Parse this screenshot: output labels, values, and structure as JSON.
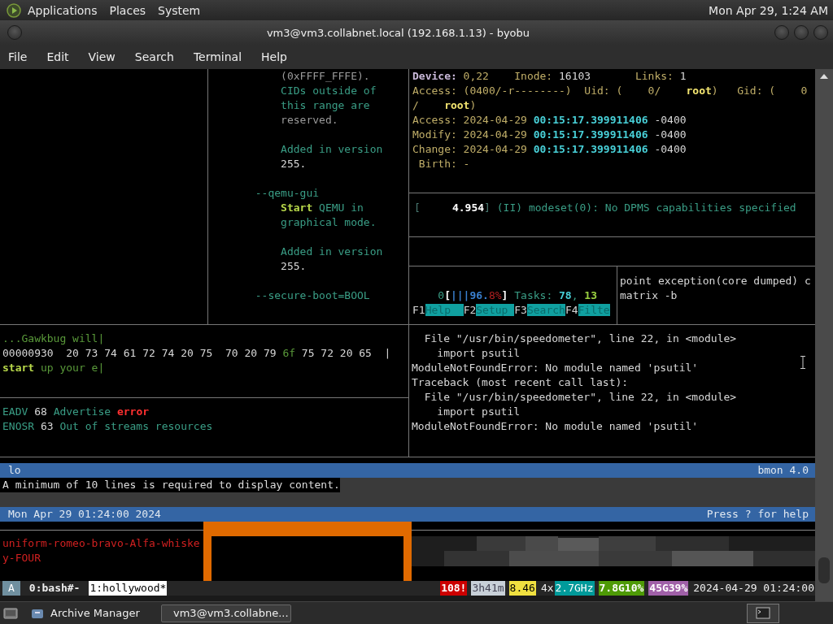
{
  "top_panel": {
    "menus": [
      "Applications",
      "Places",
      "System"
    ],
    "clock": "Mon Apr 29, 1:24 AM"
  },
  "window": {
    "title": "vm3@vm3.collabnet.local (192.168.1.13) - byobu"
  },
  "menu_bar": [
    "File",
    "Edit",
    "View",
    "Search",
    "Terminal",
    "Help"
  ],
  "panes": {
    "man_page": [
      [
        [
          {
            "text": "           (0xFFFF_FFFE).",
            "kind": "dim"
          }
        ],
        [
          {
            "text": "           CIDs outside of",
            "kind": "teal"
          }
        ],
        [
          {
            "text": "           this range are",
            "kind": "teal"
          }
        ],
        [
          {
            "text": "           reserved.",
            "kind": "dim"
          }
        ]
      ],
      [
        [
          {
            "text": "           Added in version",
            "kind": "teal"
          }
        ],
        [
          {
            "text": "           255.",
            "kind": "plain"
          }
        ]
      ],
      [
        [
          {
            "text": "       --qemu-gui",
            "kind": "teal"
          }
        ],
        [
          {
            "text": "           Start",
            "kind": "lime"
          },
          {
            "text": " QEMU in",
            "kind": "teal"
          }
        ],
        [
          {
            "text": "           graphical mode.",
            "kind": "teal"
          }
        ]
      ],
      [
        [
          {
            "text": "           Added in version",
            "kind": "teal"
          }
        ],
        [
          {
            "text": "           255.",
            "kind": "plain"
          }
        ]
      ],
      [
        [
          {
            "text": "       --secure-boot=BOOL",
            "kind": "teal"
          }
        ]
      ]
    ],
    "stat": [
      [
        {
          "text": "Device:",
          "kind": "lavender"
        },
        {
          "text": " 0,22    Inode:",
          "kind": "olive"
        },
        {
          "text": " 16103",
          "kind": "plain"
        },
        {
          "text": "       Links:",
          "kind": "olive"
        },
        {
          "text": " 1",
          "kind": "plain"
        }
      ],
      [
        {
          "text": "Access: (0400/-r--------)  Uid: (    0/    ",
          "kind": "olive"
        },
        {
          "text": "root",
          "kind": "gold"
        },
        {
          "text": ")   Gid: (    0",
          "kind": "olive"
        }
      ],
      [
        {
          "text": "/    ",
          "kind": "olive"
        },
        {
          "text": "root",
          "kind": "gold"
        },
        {
          "text": ")",
          "kind": "olive"
        }
      ],
      [
        {
          "text": "Access: 2024-04-29 ",
          "kind": "olive"
        },
        {
          "text": "00:15:17.399911406",
          "kind": "cyan"
        },
        {
          "text": " -0400",
          "kind": "plain"
        }
      ],
      [
        {
          "text": "Modify: 2024-04-29 ",
          "kind": "olive"
        },
        {
          "text": "00:15:17.399911406",
          "kind": "cyan"
        },
        {
          "text": " -0400",
          "kind": "plain"
        }
      ],
      [
        {
          "text": "Change: 2024-04-29 ",
          "kind": "olive"
        },
        {
          "text": "00:15:17.399911406",
          "kind": "cyan"
        },
        {
          "text": " -0400",
          "kind": "plain"
        }
      ],
      [
        {
          "text": " Birth: -",
          "kind": "olive"
        }
      ]
    ],
    "dmesg": [
      [
        {
          "text": "[",
          "kind": "dimteal"
        },
        {
          "text": "     4.954",
          "kind": "white"
        },
        {
          "text": "]",
          "kind": "dimteal"
        },
        {
          "text": " (II) modeset(0): No DPMS capabilities specified",
          "kind": "teal"
        }
      ]
    ],
    "htop": [
      [
        {
          "text": "    0",
          "kind": "teal"
        },
        {
          "text": "[",
          "kind": "white"
        },
        {
          "text": "|||96.",
          "kind": "blue"
        },
        {
          "text": "8%",
          "kind": "red"
        },
        {
          "text": "]",
          "kind": "white"
        },
        {
          "text": " Tasks: ",
          "kind": "teal"
        },
        {
          "text": "78",
          "kind": "cyan"
        },
        {
          "text": ", ",
          "kind": "teal"
        },
        {
          "text": "13",
          "kind": "green"
        }
      ],
      [
        {
          "text": "F1",
          "kind": "plain"
        },
        {
          "text": "Help  ",
          "kind": "key"
        },
        {
          "text": "F2",
          "kind": "plain"
        },
        {
          "text": "Setup ",
          "kind": "key"
        },
        {
          "text": "F3",
          "kind": "plain"
        },
        {
          "text": "Search",
          "kind": "key"
        },
        {
          "text": "F4",
          "kind": "plain"
        },
        {
          "text": "Filte",
          "kind": "key"
        }
      ]
    ],
    "shell": [
      [
        {
          "text": "point exception(core dumped) c",
          "kind": "plain"
        }
      ],
      [
        {
          "text": "matrix -b",
          "kind": "plain"
        }
      ]
    ],
    "hexdump": [
      [
        {
          "text": "...Gawkbug will|",
          "kind": "leaf"
        }
      ],
      [
        {
          "text": "00000930  20 73 74 61 72 74 20 75  70 20 79 ",
          "kind": "plain"
        },
        {
          "text": "6f",
          "kind": "leaf"
        },
        {
          "text": " 75 72 20 65  |",
          "kind": "plain"
        }
      ],
      [
        {
          "text": "start",
          "kind": "lime"
        },
        {
          "text": " up your e|",
          "kind": "leaf"
        }
      ]
    ],
    "errno": [
      [
        {
          "text": "EADV",
          "kind": "teal"
        },
        {
          "text": " 68 ",
          "kind": "plain"
        },
        {
          "text": "Advertise ",
          "kind": "teal"
        },
        {
          "text": "error",
          "kind": "alarm"
        }
      ],
      [
        {
          "text": "ENOSR",
          "kind": "teal"
        },
        {
          "text": " 63 ",
          "kind": "plain"
        },
        {
          "text": "Out of streams resources",
          "kind": "teal"
        }
      ]
    ],
    "traceback": [
      [
        {
          "text": "  File \"/usr/bin/speedometer\", line 22, in <module>",
          "kind": "plain"
        }
      ],
      [
        {
          "text": "    import psutil",
          "kind": "plain"
        }
      ],
      [
        {
          "text": "ModuleNotFoundError: No module named 'psutil'",
          "kind": "plain"
        }
      ],
      [
        {
          "text": "Traceback (most recent call last):",
          "kind": "plain"
        }
      ],
      [
        {
          "text": "  File \"/usr/bin/speedometer\", line 22, in <module>",
          "kind": "plain"
        }
      ],
      [
        {
          "text": "    import psutil",
          "kind": "plain"
        }
      ],
      [
        {
          "text": "ModuleNotFoundError: No module named 'psutil'",
          "kind": "plain"
        }
      ]
    ]
  },
  "bmon": {
    "interface": "lo",
    "version": "bmon 4.0",
    "message": "A minimum of 10 lines is required to display content.",
    "date": "Mon Apr 29 01:24:00 2024",
    "help": "Press ? for help"
  },
  "hollywood": {
    "lines": [
      "uniform-romeo-bravo-Alfa-whiske",
      "y-FOUR"
    ]
  },
  "status_bar": {
    "session": "A",
    "windows": [
      {
        "label": "0:bash#-",
        "selected": false
      },
      {
        "label": "1:hollywood*",
        "selected": true
      }
    ],
    "items": [
      {
        "text": "108!",
        "kind": "alert"
      },
      {
        "text": "3h41m",
        "kind": "uptime"
      },
      {
        "text": "8.46",
        "kind": "load"
      },
      {
        "text": "4x",
        "kind": "prefix"
      },
      {
        "text": "2.7GHz",
        "kind": "cpu"
      },
      {
        "text": "7.8G10%",
        "kind": "mem"
      },
      {
        "text": "45G39%",
        "kind": "disk"
      },
      {
        "text": "2024-04-29 01:24:00",
        "kind": "plain"
      }
    ]
  },
  "taskbar": {
    "tasks": [
      {
        "label": "Archive Manager",
        "selected": false
      },
      {
        "label": "vm3@vm3.collabne...",
        "selected": true
      }
    ]
  }
}
